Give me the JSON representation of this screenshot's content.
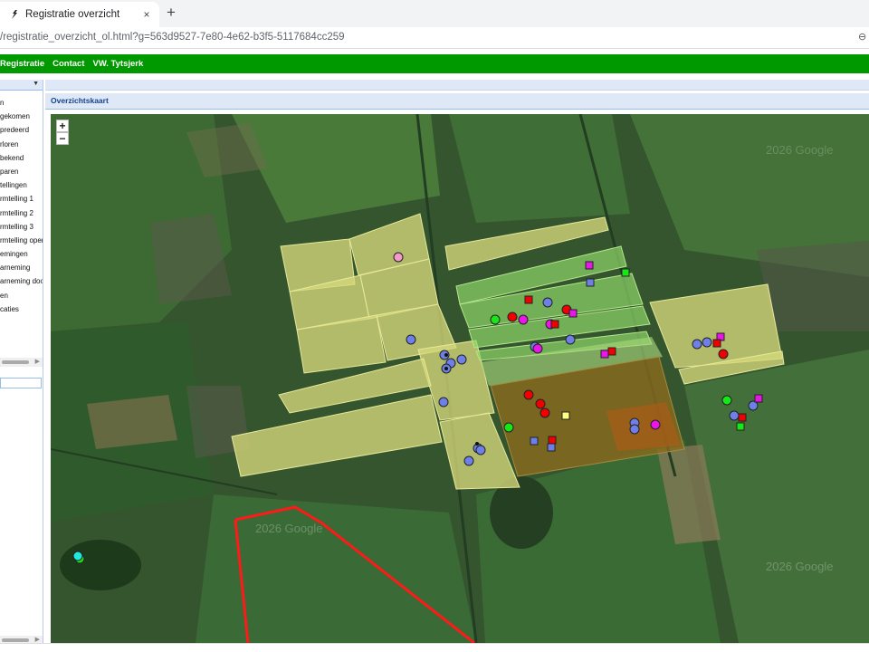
{
  "browser": {
    "tab_title": "Registratie overzicht",
    "tab_close": "×",
    "new_tab": "+",
    "url": "/registratie_overzicht_ol.html?g=563d9527-7e80-4e62-b3f5-5117684cc259"
  },
  "navbar": {
    "items": [
      "Registratie",
      "Contact",
      "VW. Tytsjerk"
    ]
  },
  "sidebar": {
    "items": [
      "n",
      "gekomen",
      "predeerd",
      "rloren",
      "bekend",
      "paren",
      "tellingen",
      "rmtelling 1",
      "rmtelling 2",
      "rmtelling 3",
      "rmtelling oper",
      "emingen",
      "arneming",
      "arneming doo",
      "en",
      "caties"
    ]
  },
  "panel": {
    "title": "Overzichtskaart"
  },
  "map": {
    "zoom_in": "+",
    "zoom_out": "−",
    "watermark": "2026 Google",
    "colors": {
      "field_yellow": "#d6d97a",
      "field_green": "#8ed66a",
      "field_brown": "#8a6a1e",
      "boundary": "#ff1a1a",
      "marker_blue": "#6f7fe8",
      "marker_red": "#f00000",
      "marker_magenta": "#e816e8",
      "marker_green": "#16e816",
      "marker_pink": "#f29acb",
      "marker_yellow": "#ffff80",
      "marker_cyan": "#20e8e0"
    }
  }
}
